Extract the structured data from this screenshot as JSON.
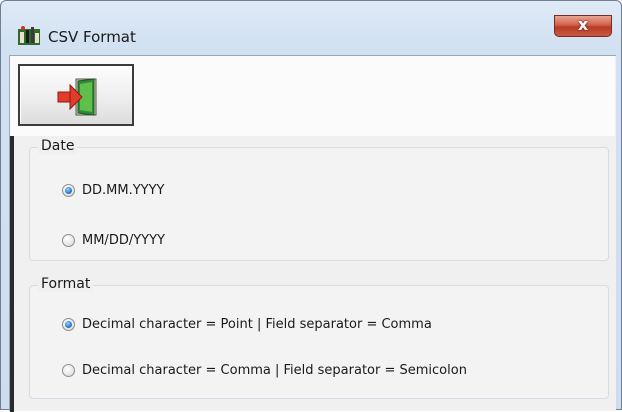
{
  "window": {
    "title": "CSV Format",
    "app_icon": "csv-format-app-icon",
    "close_label": "x"
  },
  "toolbar": {
    "exit_icon": "exit-door-icon"
  },
  "date_group": {
    "label": "Date",
    "options": [
      {
        "label": "DD.MM.YYYY",
        "checked": true
      },
      {
        "label": "MM/DD/YYYY",
        "checked": false
      }
    ]
  },
  "format_group": {
    "label": "Format",
    "options": [
      {
        "label": "Decimal character = Point |  Field separator = Comma",
        "checked": true
      },
      {
        "label": "Decimal character = Comma |  Field separator = Semicolon",
        "checked": false
      }
    ]
  },
  "colors": {
    "accent_radio": "#2a7fd6",
    "close_button": "#c8513a"
  }
}
